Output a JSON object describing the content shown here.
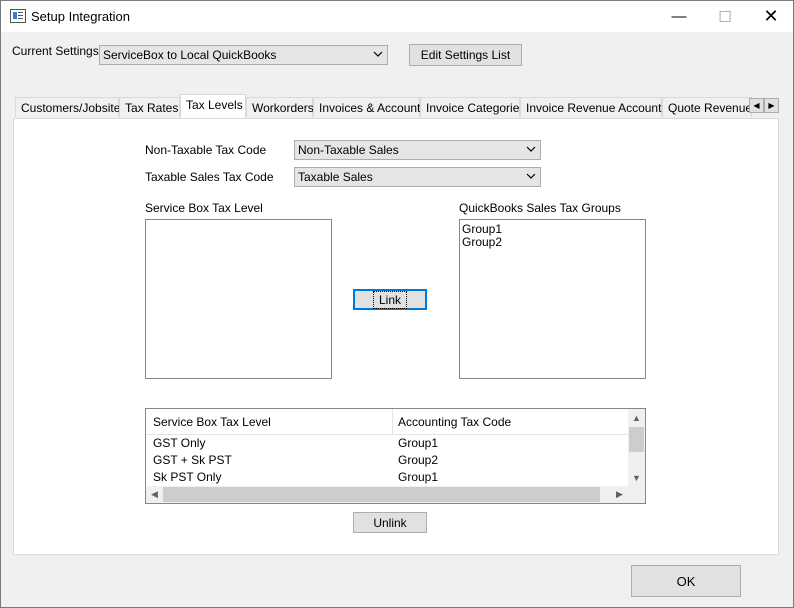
{
  "window": {
    "title": "Setup Integration",
    "minimize_glyph": "—",
    "maximize_glyph": "☐",
    "close_glyph": "✕"
  },
  "current_settings": {
    "label": "Current Settings",
    "selected": "ServiceBox to Local QuickBooks",
    "edit_button": "Edit Settings List"
  },
  "tabs": [
    {
      "label": "Customers/Jobsites",
      "active": false
    },
    {
      "label": "Tax Rates",
      "active": false
    },
    {
      "label": "Tax Levels",
      "active": true
    },
    {
      "label": "Workorders",
      "active": false
    },
    {
      "label": "Invoices & Accounts",
      "active": false
    },
    {
      "label": "Invoice Categories",
      "active": false
    },
    {
      "label": "Invoice Revenue Accounts",
      "active": false
    },
    {
      "label": "Quote Revenue .",
      "active": false
    }
  ],
  "tax_codes": {
    "non_taxable_label": "Non-Taxable Tax Code",
    "non_taxable_value": "Non-Taxable Sales",
    "taxable_label": "Taxable Sales Tax Code",
    "taxable_value": "Taxable Sales"
  },
  "servicebox_list": {
    "label": "Service Box Tax Level",
    "items": []
  },
  "quickbooks_list": {
    "label": "QuickBooks Sales Tax Groups",
    "items": [
      "Group1",
      "Group2"
    ]
  },
  "link_button": "Link",
  "unlink_button": "Unlink",
  "mapping_table": {
    "columns": [
      "Service Box Tax Level",
      "Accounting Tax Code"
    ],
    "rows": [
      [
        "GST Only",
        "Group1"
      ],
      [
        "GST + Sk PST",
        "Group2"
      ],
      [
        "Sk PST Only",
        "Group1"
      ]
    ]
  },
  "ok_button": "OK",
  "colors": {
    "focus_blue": "#0078d7",
    "button_face": "#e1e1e1",
    "window_bg": "#f0f0f0"
  }
}
